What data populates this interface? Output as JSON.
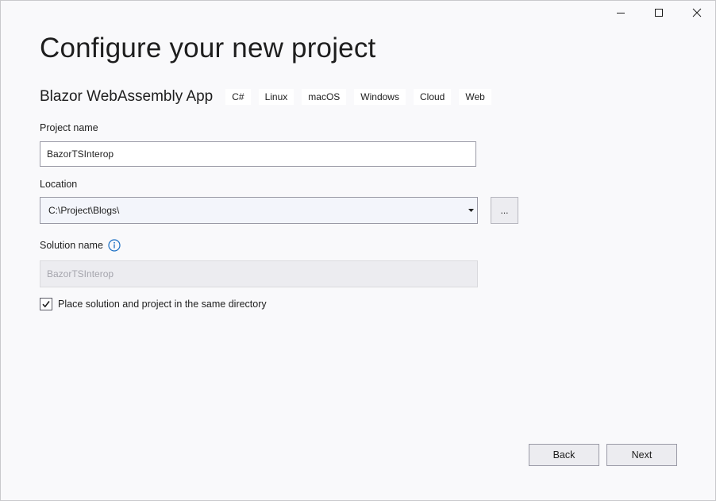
{
  "window": {
    "controls": {
      "minimize_icon": "minimize-icon",
      "maximize_icon": "maximize-icon",
      "close_icon": "close-icon"
    }
  },
  "title": "Configure your new project",
  "template": {
    "name": "Blazor WebAssembly App",
    "tags": [
      "C#",
      "Linux",
      "macOS",
      "Windows",
      "Cloud",
      "Web"
    ]
  },
  "project_name": {
    "label": "Project name",
    "value": "BazorTSInterop"
  },
  "location": {
    "label": "Location",
    "value": "C:\\Project\\Blogs\\",
    "browse_label": "..."
  },
  "solution_name": {
    "label": "Solution name",
    "value": "BazorTSInterop",
    "info_icon": "info-icon",
    "disabled": true
  },
  "same_directory": {
    "label": "Place solution and project in the same directory",
    "checked": true
  },
  "buttons": {
    "back": "Back",
    "next": "Next"
  },
  "colors": {
    "background": "#f9f9fb",
    "accent": "#1a6fc4",
    "disabled_field": "#ececf0"
  }
}
